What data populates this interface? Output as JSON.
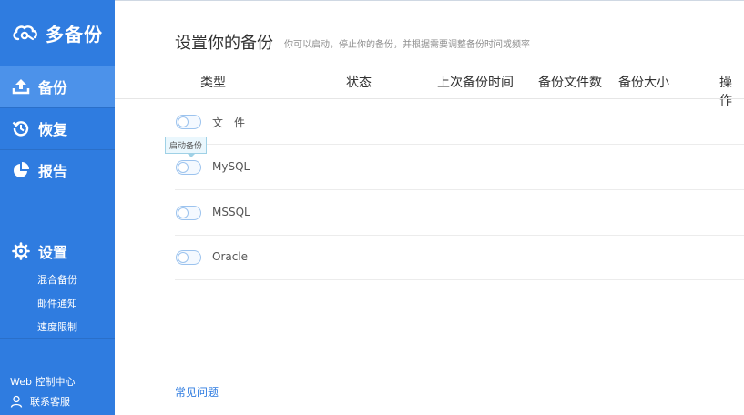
{
  "sidebar": {
    "brand": "多备份",
    "nav": [
      {
        "label": "备份",
        "icon": "upload-icon",
        "active": true
      },
      {
        "label": "恢复",
        "icon": "history-icon",
        "active": false
      },
      {
        "label": "报告",
        "icon": "pie-chart-icon",
        "active": false
      }
    ],
    "settings": {
      "label": "设置",
      "icon": "gear-icon",
      "sub_items": [
        "混合备份",
        "邮件通知",
        "速度限制"
      ]
    },
    "footer": {
      "web_console": "Web 控制中心",
      "support": "联系客服"
    }
  },
  "main": {
    "title": "设置你的备份",
    "subtitle": "你可以启动，停止你的备份，并根据需要调整备份时间或频率",
    "columns": [
      "类型",
      "状态",
      "上次备份时间",
      "备份文件数",
      "备份大小",
      "操作"
    ],
    "rows": [
      {
        "label": "文　件",
        "enabled": false
      },
      {
        "label": "MySQL",
        "enabled": false
      },
      {
        "label": "MSSQL",
        "enabled": false
      },
      {
        "label": "Oracle",
        "enabled": false
      }
    ],
    "tooltip": "启动备份",
    "faq": "常见问题"
  },
  "colors": {
    "sidebar_bg": "#2f7ce0",
    "sidebar_active": "#4c92ea",
    "accent": "#2f7ce0"
  }
}
